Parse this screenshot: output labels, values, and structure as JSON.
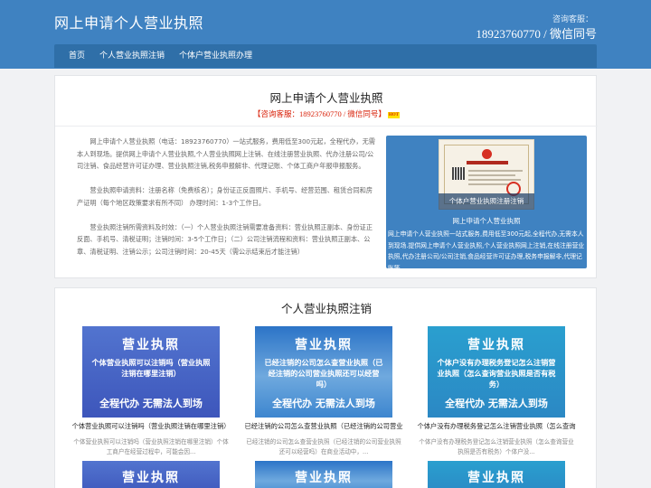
{
  "header": {
    "site_title": "网上申请个人营业执照",
    "hotline_label": "咨询客服：",
    "hotline": "18923760770 / 微信同号"
  },
  "nav": {
    "items": [
      "首页",
      "个人营业执照注销",
      "个体户营业执照办理"
    ]
  },
  "intro": {
    "title": "网上申请个人营业执照",
    "consult": "【咨询客服：18923760770 / 微信同号】",
    "hot_badge": "HOT",
    "paragraphs": [
      "网上申请个人营业执照（电话：18923760770）一站式服务，费用低至300元起，全程代办，无需本人到现场。提供网上申请个人营业执照,个人营业执照网上注销、在线注册营业执照、代办注册公司/公司注销、食品经营许可证办理、营业执照注销,税务申报解非、代理记账、个体工商户年报申报服务。",
      "营业执照申请资料：注册名称（免费核名）；身份证正反面照片、手机号、经营范围、租赁合同和房产证明（每个地区政策要求有所不同） 办理时间：1-3个工作日。",
      "营业执照注销所需资料及时效：（一）个人营业执照注销需要准备资料：营业执照正副本、身份证正反面、手机号、清税证明；注销时间：3-5个工作日；（二）公司注销流程和资料：营业执照正副本、公章、清税证明、注销公示；公司注销时间：20-45天（需公示结束后才能注销）"
    ],
    "feature_caption": "个体户营业执照注册注销",
    "feature_title": "网上申请个人营业执照",
    "feature_desc": "网上申请个人营业执照一站式服务,费用低至300元起,全程代办,无需本人到现场.提供网上申请个人营业执照,个人营业执照网上注销,在线注册营业执照,代办注册公司/公司注销,食品经营许可证办理,税务申报解非,代理记账等"
  },
  "cancellation": {
    "title": "个人营业执照注销",
    "cards": [
      {
        "img_top": "营业执照",
        "img_mid": "个体营业执照可以注销吗（营业执照注销在哪里注销）",
        "img_bot": "全程代办  无需法人到场",
        "title": "个体营业执照可以注销吗（营业执照注销在哪里注销）",
        "desc": "个体营业执照可以注销吗（营业执照注销在哪里注销）个体工商户在经营过程中，可能会因..."
      },
      {
        "img_top": "营业执照",
        "img_mid": "已经注销的公司怎么查营业执照（已经注销的公司营业执照还可以经营吗）",
        "img_bot": "全程代办  无需法人到场",
        "title": "已经注销的公司怎么查营业执照（已经注销的公司营业",
        "desc": "已经注销的公司怎么查营业执照（已经注销的公司营业执照还可以经营吗）在商业活动中，..."
      },
      {
        "img_top": "营业执照",
        "img_mid": "个体户没有办理税务登记怎么注销营业执照（怎么查询营业执照是否有税务）",
        "img_bot": "全程代办  无需法人到场",
        "title": "个体户没有办理税务登记怎么注销营业执照（怎么查询",
        "desc": "个体户没有办理税务登记怎么注销营业执照（怎么查询营业执照是否有税务）个体户没..."
      }
    ],
    "next_row_label": "营业执照"
  }
}
